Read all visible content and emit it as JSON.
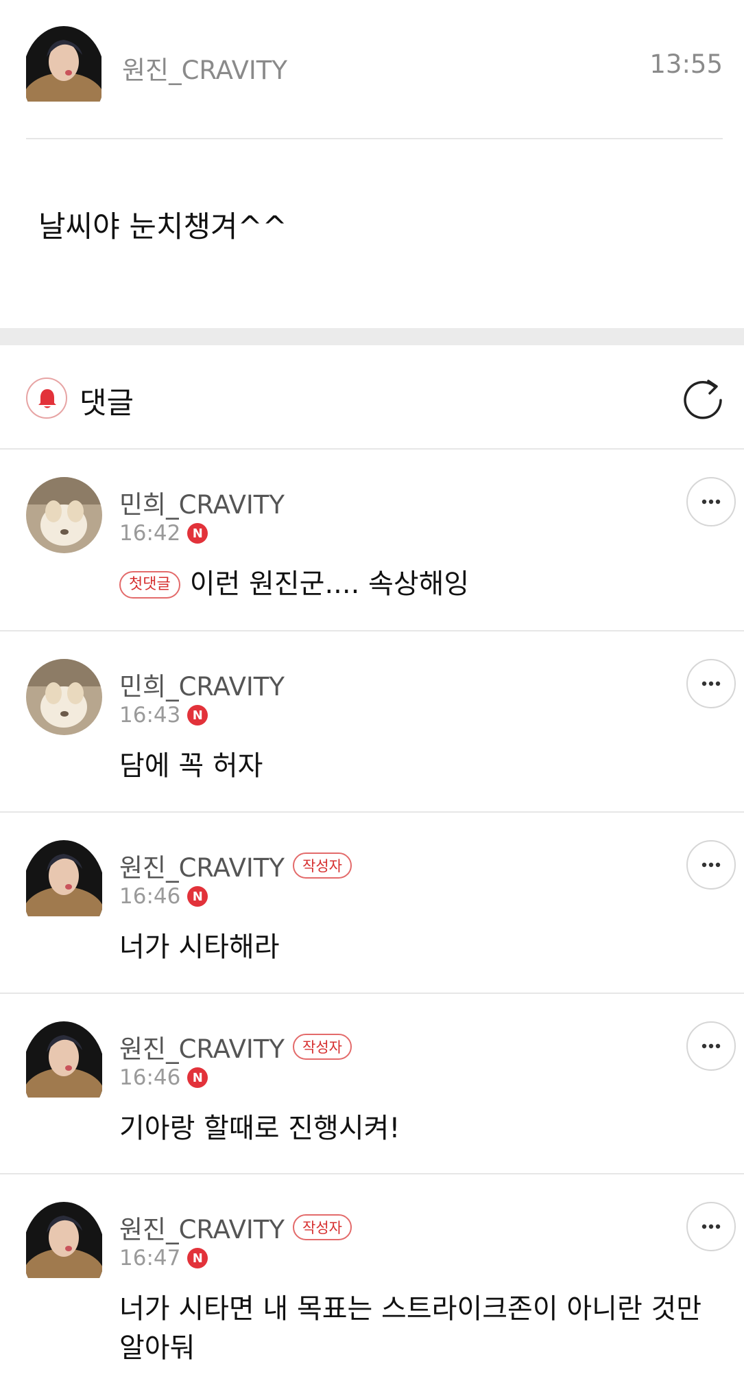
{
  "post": {
    "author": "원진_CRAVITY",
    "time": "13:55",
    "body": "날씨야 눈치챙겨^^"
  },
  "comments_header": {
    "title": "댓글",
    "icons": [
      "bell-icon",
      "refresh-icon"
    ]
  },
  "comments": [
    {
      "name": "민희_CRAVITY",
      "time": "16:42",
      "new_badge": "N",
      "first_badge": "첫댓글",
      "author_badge": null,
      "text": "이런 원진군.... 속상해잉",
      "avatar": "dog-avatar"
    },
    {
      "name": "민희_CRAVITY",
      "time": "16:43",
      "new_badge": "N",
      "first_badge": null,
      "author_badge": null,
      "text": "담에 꼭 허자",
      "avatar": "dog-avatar"
    },
    {
      "name": "원진_CRAVITY",
      "time": "16:46",
      "new_badge": "N",
      "first_badge": null,
      "author_badge": "작성자",
      "text": "너가 시타해라",
      "avatar": "person-avatar"
    },
    {
      "name": "원진_CRAVITY",
      "time": "16:46",
      "new_badge": "N",
      "first_badge": null,
      "author_badge": "작성자",
      "text": "기아랑 할때로 진행시켜!",
      "avatar": "person-avatar"
    },
    {
      "name": "원진_CRAVITY",
      "time": "16:47",
      "new_badge": "N",
      "first_badge": null,
      "author_badge": "작성자",
      "text": "너가 시타면 내 목표는 스트라이크존이 아니란 것만 알아둬",
      "avatar": "person-avatar"
    }
  ],
  "colors": {
    "accent_red": "#e2323a",
    "badge_border": "#e36a6a",
    "divider": "#e6e6e6",
    "muted_text": "#8a8a8a"
  }
}
